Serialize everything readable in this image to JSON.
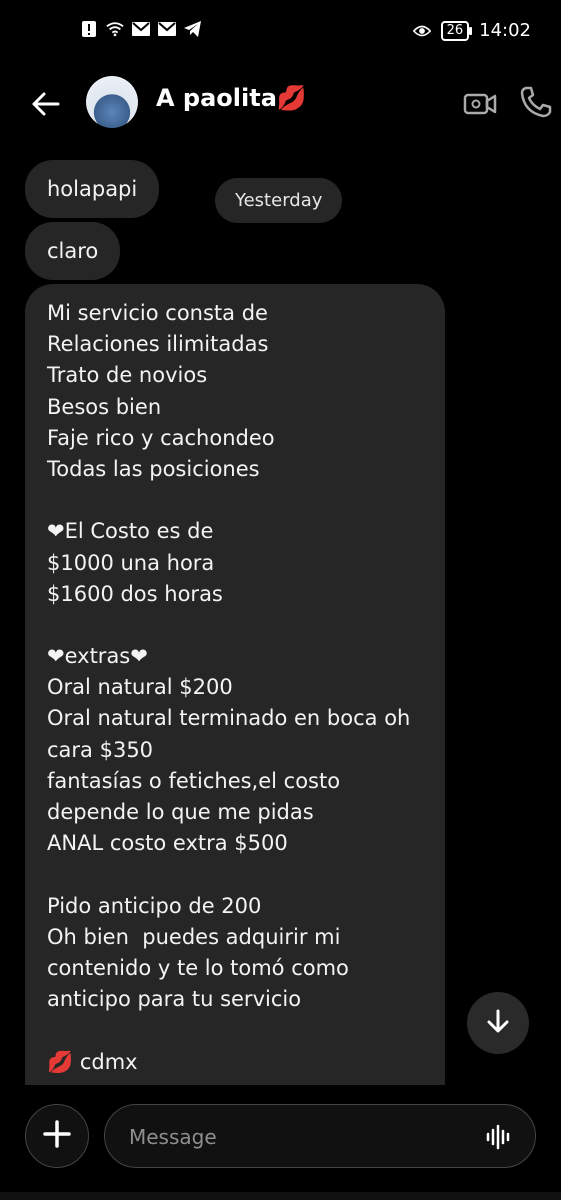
{
  "status_bar": {
    "time": "14:02",
    "battery": "26",
    "icons": [
      "alert-icon",
      "wifi-icon",
      "mail-icon",
      "mail-icon",
      "telegram-icon",
      "eye-icon"
    ]
  },
  "header": {
    "contact_name": "A paolita💋"
  },
  "chat": {
    "date_label": "Yesterday",
    "messages": [
      {
        "text": "holapapi"
      },
      {
        "text": "claro"
      }
    ],
    "long_message_lines": [
      "Mi servicio consta de",
      "Relaciones ilimitadas",
      "Trato de novios",
      "Besos bien",
      "Faje rico y cachondeo",
      "Todas las posiciones",
      "",
      "❤El Costo es de",
      "$1000 una hora",
      "$1600 dos horas",
      "",
      "❤extras❤",
      "Oral natural $200",
      "Oral natural terminado en boca oh",
      "cara $350",
      "fantasías o fetiches,el costo",
      "depende lo que me pidas",
      "ANAL costo extra $500",
      "",
      "Pido anticipo de 200",
      "Oh bien  puedes adquirir mi",
      "contenido y te lo tomó como",
      "anticipo para tu servicio",
      "",
      "💋 cdmx"
    ]
  },
  "composer": {
    "placeholder": "Message"
  },
  "colors": {
    "background": "#000000",
    "bubble": "#262626",
    "heart": "#e33d3d"
  }
}
